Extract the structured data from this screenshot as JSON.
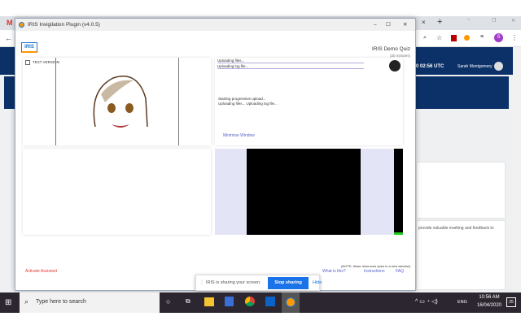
{
  "browser": {
    "user_initial": "S",
    "header_time": "0 02:56 UTC",
    "user_name": "Sarah Montgomery",
    "bg_text": "provide valuable marking and feedback to"
  },
  "window": {
    "title": "IRIS Invigilation Plugin (v4.0.5)",
    "minimize": "–",
    "maximize": "☐",
    "close": "✕"
  },
  "header": {
    "logo": "IRIS",
    "quiz_title": "IRIS Demo Quiz",
    "duration": "(20 minutes)"
  },
  "panels": {
    "text_version": "TEXT VERSION",
    "log": [
      "Uploading files...",
      "Uploading log file..."
    ],
    "progress": [
      "Starting progressive upload...",
      "Uploading files... Uploading log file..."
    ],
    "minimise": "Minimise Window"
  },
  "footer": {
    "activate": "Activate Assistant",
    "note": "(NOTE: these resources open in a new window)",
    "links": [
      "What is this?",
      "Instructions",
      "FAQ"
    ]
  },
  "share": {
    "message": "IRIS is sharing your screen.",
    "stop": "Stop sharing",
    "hide": "Hide"
  },
  "taskbar": {
    "search_placeholder": "Type here to search",
    "lang": "ENG",
    "time": "10:56 AM",
    "date": "16/04/2020",
    "notif": "25"
  },
  "colors": {
    "navy": "#0b3168",
    "accent": "#1a73e8",
    "red": "#e53935"
  }
}
